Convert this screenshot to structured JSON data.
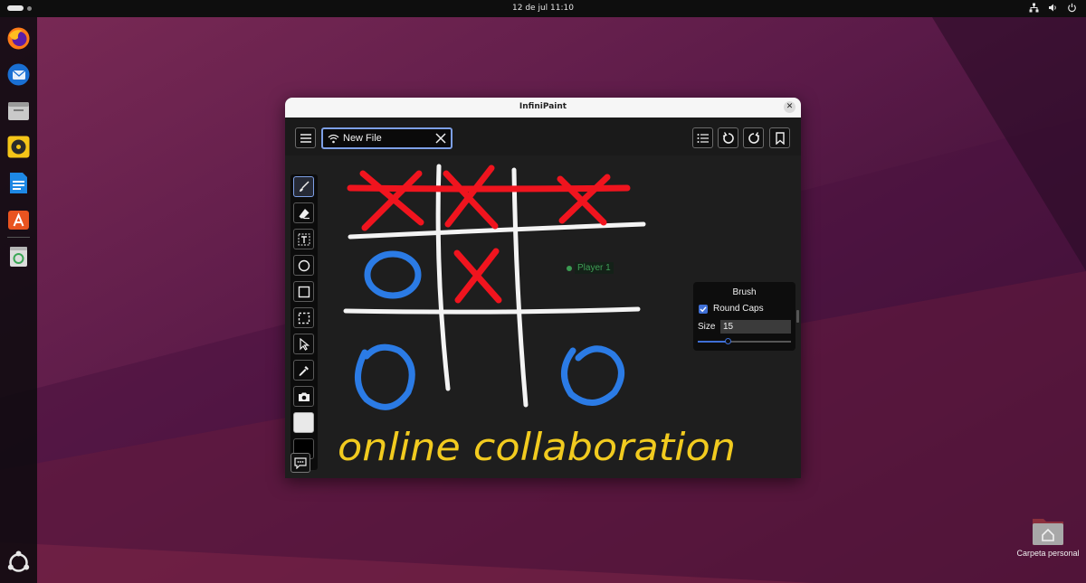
{
  "topbar": {
    "clock": "12 de jul  11:10"
  },
  "dock": {
    "items": [
      "firefox-icon",
      "thunderbird-icon",
      "files-icon",
      "rhythmbox-icon",
      "writer-icon",
      "app-center-icon",
      "trash-icon",
      "ubuntu-logo"
    ]
  },
  "desktop": {
    "home_label": "Carpeta personal"
  },
  "window": {
    "title": "InfiniPaint",
    "file_name": "New File",
    "player_name": "Player 1",
    "drawing_text": "online collaboration",
    "brush": {
      "heading": "Brush",
      "round_caps_label": "Round Caps",
      "round_caps_checked": true,
      "size_label": "Size",
      "size_value": "15",
      "size_fraction": 0.32
    },
    "tools": [
      "brush-tool",
      "eraser-tool",
      "text-tool",
      "ellipse-tool",
      "rectangle-tool",
      "select-rect-tool",
      "pointer-tool",
      "eyedropper-tool",
      "screenshot-tool",
      "primary-color-swatch",
      "secondary-color-swatch"
    ]
  },
  "colors": {
    "accent": "#7d9fe6",
    "x_marks": "#f0141e",
    "o_marks": "#2b7be5",
    "grid": "#f4f4f4",
    "text_ink": "#f2cb1f",
    "player": "#3b9b52"
  }
}
